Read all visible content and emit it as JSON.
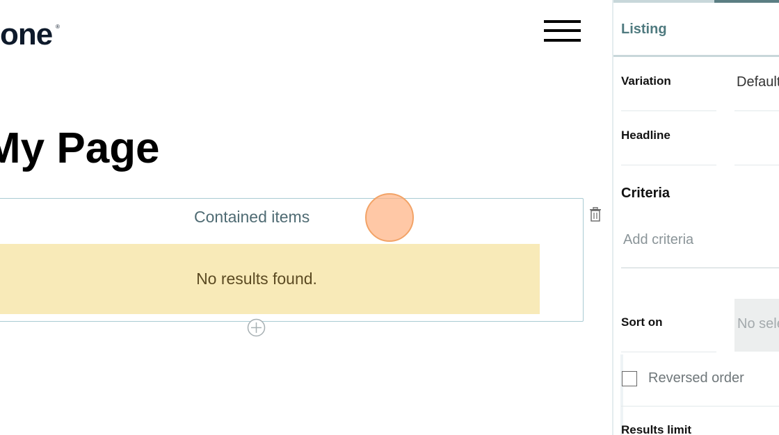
{
  "canvas": {
    "logo_text": "one",
    "logo_reg": "®",
    "page_title": "My Page",
    "block": {
      "title": "Contained items",
      "empty_message": "No results found."
    }
  },
  "sidebar": {
    "title": "Listing",
    "fields": {
      "variation_label": "Variation",
      "variation_value": "Default",
      "headline_label": "Headline",
      "criteria_heading": "Criteria",
      "criteria_placeholder": "Add criteria",
      "sort_label": "Sort on",
      "sort_placeholder": "No selection",
      "reversed_label": "Reversed order",
      "results_limit_label": "Results limit"
    }
  },
  "icons": {
    "menu": "hamburger-icon",
    "delete": "trash-icon",
    "add": "plus-circle-icon"
  },
  "colors": {
    "accent": "#4f7a7f",
    "block_border": "#a9cbd3",
    "empty_bg": "#f8eab8",
    "cursor": "#f2a367"
  }
}
